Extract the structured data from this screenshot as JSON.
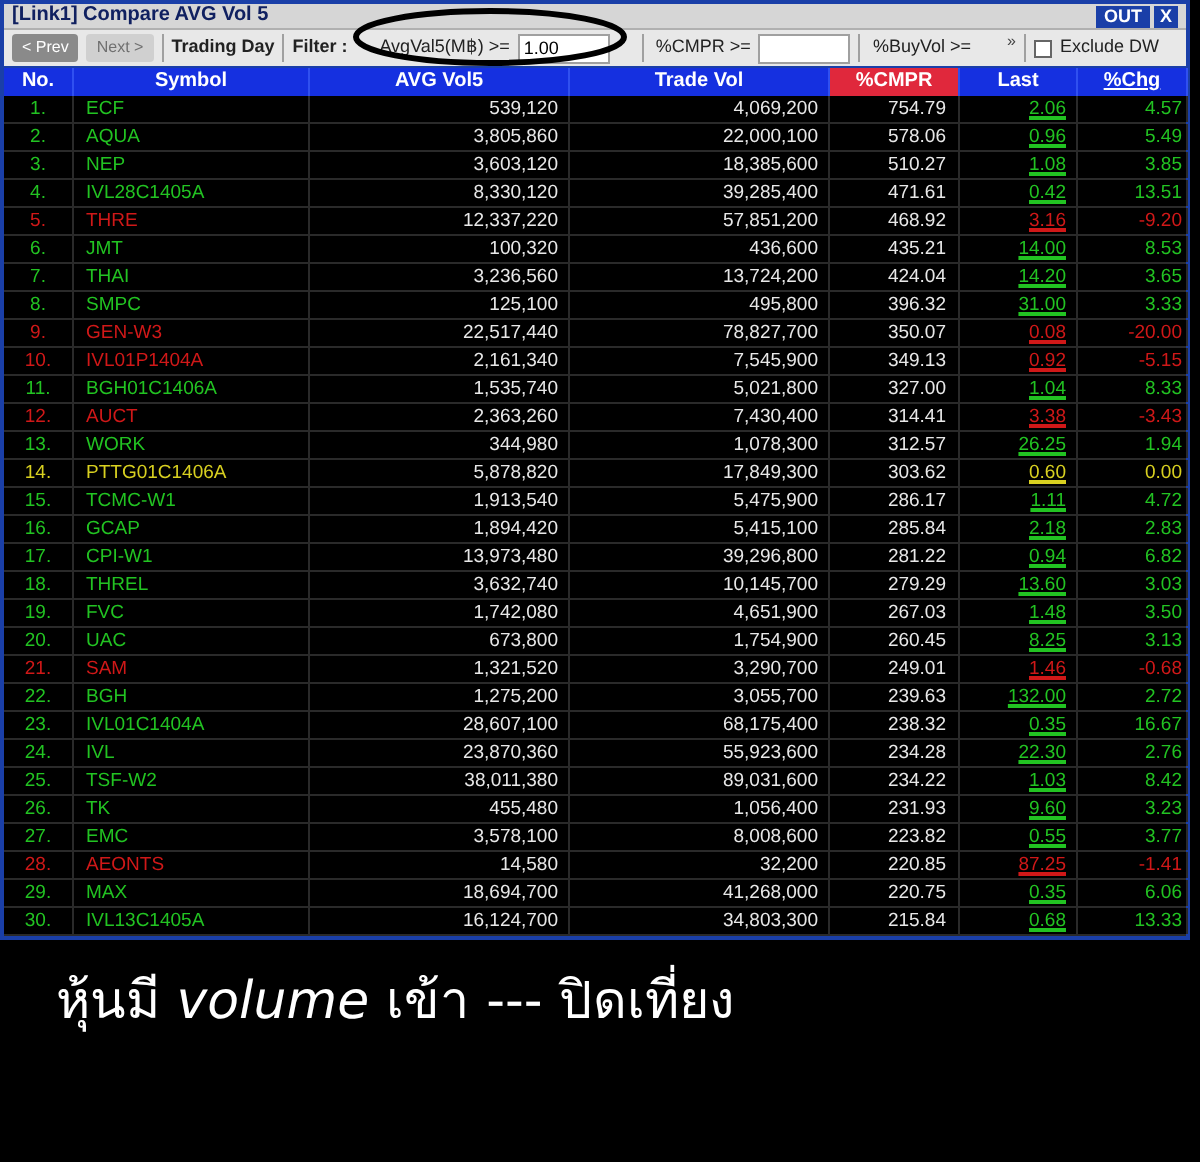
{
  "window": {
    "title": "[Link1] Compare AVG Vol 5",
    "buttons": [
      "OUT",
      "X"
    ]
  },
  "toolbar": {
    "prev": {
      "label": "< Prev",
      "disabled": false
    },
    "next": {
      "label": "Next >",
      "disabled": true
    },
    "trading_day": "Trading Day",
    "filter_label": "Filter :",
    "filters": [
      {
        "kind": "input",
        "label": "AvgVal5(M฿) >=",
        "value": "1.00"
      },
      {
        "kind": "input",
        "label": "%CMPR >="
      },
      {
        "kind": "text",
        "label": "%BuyVol >=",
        "more": "»"
      }
    ],
    "exclude_dw": {
      "label": "Exclude DW",
      "checked": false
    }
  },
  "table": {
    "columns": [
      {
        "label": "No.",
        "sorted": false
      },
      {
        "label": "Symbol",
        "sorted": false
      },
      {
        "label": "AVG Vol5",
        "sorted": false
      },
      {
        "label": "Trade Vol",
        "sorted": false
      },
      {
        "label": "%CMPR",
        "sorted": true
      },
      {
        "label": "Last",
        "sorted": false
      },
      {
        "label": "%Chg",
        "sorted": false
      }
    ],
    "rows": [
      {
        "no": "1.",
        "symbol": "ECF",
        "avg_vol5": "539,120",
        "trade_vol": "4,069,200",
        "cmpr": "754.79",
        "last": "2.06",
        "chg": "4.57",
        "color": "#22c322"
      },
      {
        "no": "2.",
        "symbol": "AQUA",
        "avg_vol5": "3,805,860",
        "trade_vol": "22,000,100",
        "cmpr": "578.06",
        "last": "0.96",
        "chg": "5.49",
        "color": "#22c322"
      },
      {
        "no": "3.",
        "symbol": "NEP",
        "avg_vol5": "3,603,120",
        "trade_vol": "18,385,600",
        "cmpr": "510.27",
        "last": "1.08",
        "chg": "3.85",
        "color": "#22c322"
      },
      {
        "no": "4.",
        "symbol": "IVL28C1405A",
        "avg_vol5": "8,330,120",
        "trade_vol": "39,285,400",
        "cmpr": "471.61",
        "last": "0.42",
        "chg": "13.51",
        "color": "#22c322"
      },
      {
        "no": "5.",
        "symbol": "THRE",
        "avg_vol5": "12,337,220",
        "trade_vol": "57,851,200",
        "cmpr": "468.92",
        "last": "3.16",
        "chg": "-9.20",
        "color": "#d01818"
      },
      {
        "no": "6.",
        "symbol": "JMT",
        "avg_vol5": "100,320",
        "trade_vol": "436,600",
        "cmpr": "435.21",
        "last": "14.00",
        "chg": "8.53",
        "color": "#22c322"
      },
      {
        "no": "7.",
        "symbol": "THAI",
        "avg_vol5": "3,236,560",
        "trade_vol": "13,724,200",
        "cmpr": "424.04",
        "last": "14.20",
        "chg": "3.65",
        "color": "#22c322"
      },
      {
        "no": "8.",
        "symbol": "SMPC",
        "avg_vol5": "125,100",
        "trade_vol": "495,800",
        "cmpr": "396.32",
        "last": "31.00",
        "chg": "3.33",
        "color": "#22c322"
      },
      {
        "no": "9.",
        "symbol": "GEN-W3",
        "avg_vol5": "22,517,440",
        "trade_vol": "78,827,700",
        "cmpr": "350.07",
        "last": "0.08",
        "chg": "-20.00",
        "color": "#d01818"
      },
      {
        "no": "10.",
        "symbol": "IVL01P1404A",
        "avg_vol5": "2,161,340",
        "trade_vol": "7,545,900",
        "cmpr": "349.13",
        "last": "0.92",
        "chg": "-5.15",
        "color": "#d01818"
      },
      {
        "no": "11.",
        "symbol": "BGH01C1406A",
        "avg_vol5": "1,535,740",
        "trade_vol": "5,021,800",
        "cmpr": "327.00",
        "last": "1.04",
        "chg": "8.33",
        "color": "#22c322"
      },
      {
        "no": "12.",
        "symbol": "AUCT",
        "avg_vol5": "2,363,260",
        "trade_vol": "7,430,400",
        "cmpr": "314.41",
        "last": "3.38",
        "chg": "-3.43",
        "color": "#d01818"
      },
      {
        "no": "13.",
        "symbol": "WORK",
        "avg_vol5": "344,980",
        "trade_vol": "1,078,300",
        "cmpr": "312.57",
        "last": "26.25",
        "chg": "1.94",
        "color": "#22c322"
      },
      {
        "no": "14.",
        "symbol": "PTTG01C1406A",
        "avg_vol5": "5,878,820",
        "trade_vol": "17,849,300",
        "cmpr": "303.62",
        "last": "0.60",
        "chg": "0.00",
        "color": "#d8d020"
      },
      {
        "no": "15.",
        "symbol": "TCMC-W1",
        "avg_vol5": "1,913,540",
        "trade_vol": "5,475,900",
        "cmpr": "286.17",
        "last": "1.11",
        "chg": "4.72",
        "color": "#22c322"
      },
      {
        "no": "16.",
        "symbol": "GCAP",
        "avg_vol5": "1,894,420",
        "trade_vol": "5,415,100",
        "cmpr": "285.84",
        "last": "2.18",
        "chg": "2.83",
        "color": "#22c322"
      },
      {
        "no": "17.",
        "symbol": "CPI-W1",
        "avg_vol5": "13,973,480",
        "trade_vol": "39,296,800",
        "cmpr": "281.22",
        "last": "0.94",
        "chg": "6.82",
        "color": "#22c322"
      },
      {
        "no": "18.",
        "symbol": "THREL",
        "avg_vol5": "3,632,740",
        "trade_vol": "10,145,700",
        "cmpr": "279.29",
        "last": "13.60",
        "chg": "3.03",
        "color": "#22c322"
      },
      {
        "no": "19.",
        "symbol": "FVC",
        "avg_vol5": "1,742,080",
        "trade_vol": "4,651,900",
        "cmpr": "267.03",
        "last": "1.48",
        "chg": "3.50",
        "color": "#22c322"
      },
      {
        "no": "20.",
        "symbol": "UAC",
        "avg_vol5": "673,800",
        "trade_vol": "1,754,900",
        "cmpr": "260.45",
        "last": "8.25",
        "chg": "3.13",
        "color": "#22c322"
      },
      {
        "no": "21.",
        "symbol": "SAM",
        "avg_vol5": "1,321,520",
        "trade_vol": "3,290,700",
        "cmpr": "249.01",
        "last": "1.46",
        "chg": "-0.68",
        "color": "#d01818"
      },
      {
        "no": "22.",
        "symbol": "BGH",
        "avg_vol5": "1,275,200",
        "trade_vol": "3,055,700",
        "cmpr": "239.63",
        "last": "132.00",
        "chg": "2.72",
        "color": "#22c322"
      },
      {
        "no": "23.",
        "symbol": "IVL01C1404A",
        "avg_vol5": "28,607,100",
        "trade_vol": "68,175,400",
        "cmpr": "238.32",
        "last": "0.35",
        "chg": "16.67",
        "color": "#22c322"
      },
      {
        "no": "24.",
        "symbol": "IVL",
        "avg_vol5": "23,870,360",
        "trade_vol": "55,923,600",
        "cmpr": "234.28",
        "last": "22.30",
        "chg": "2.76",
        "color": "#22c322"
      },
      {
        "no": "25.",
        "symbol": "TSF-W2",
        "avg_vol5": "38,011,380",
        "trade_vol": "89,031,600",
        "cmpr": "234.22",
        "last": "1.03",
        "chg": "8.42",
        "color": "#22c322"
      },
      {
        "no": "26.",
        "symbol": "TK",
        "avg_vol5": "455,480",
        "trade_vol": "1,056,400",
        "cmpr": "231.93",
        "last": "9.60",
        "chg": "3.23",
        "color": "#22c322"
      },
      {
        "no": "27.",
        "symbol": "EMC",
        "avg_vol5": "3,578,100",
        "trade_vol": "8,008,600",
        "cmpr": "223.82",
        "last": "0.55",
        "chg": "3.77",
        "color": "#22c322"
      },
      {
        "no": "28.",
        "symbol": "AEONTS",
        "avg_vol5": "14,580",
        "trade_vol": "32,200",
        "cmpr": "220.85",
        "last": "87.25",
        "chg": "-1.41",
        "color": "#d01818"
      },
      {
        "no": "29.",
        "symbol": "MAX",
        "avg_vol5": "18,694,700",
        "trade_vol": "41,268,000",
        "cmpr": "220.75",
        "last": "0.35",
        "chg": "6.06",
        "color": "#22c322"
      },
      {
        "no": "30.",
        "symbol": "IVL13C1405A",
        "avg_vol5": "16,124,700",
        "trade_vol": "34,803,300",
        "cmpr": "215.84",
        "last": "0.68",
        "chg": "13.33",
        "color": "#22c322"
      }
    ]
  },
  "caption": "หุ้นมี *volume* เข้า --- ปิดเที่ยง"
}
